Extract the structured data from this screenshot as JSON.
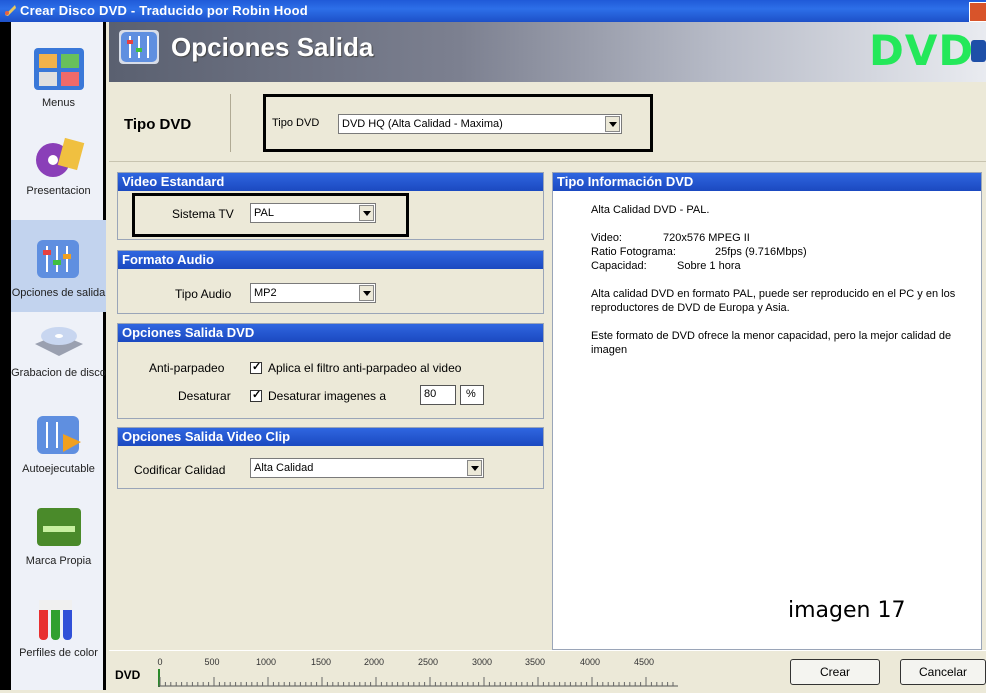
{
  "window": {
    "title": "Crear Disco DVD - Traducido por Robin Hood"
  },
  "sidebar": {
    "items": [
      {
        "label": "Menus",
        "icon": "menus-icon"
      },
      {
        "label": "Presentacion",
        "icon": "presentation-icon"
      },
      {
        "label": "Opciones de salida",
        "icon": "output-options-icon",
        "active": true
      },
      {
        "label": "Grabacion de disco",
        "icon": "disc-burn-icon"
      },
      {
        "label": "Autoejecutable",
        "icon": "autorun-icon"
      },
      {
        "label": "Marca Propia",
        "icon": "branding-icon"
      },
      {
        "label": "Perfiles de color",
        "icon": "color-profiles-icon"
      }
    ]
  },
  "header": {
    "title": "Opciones Salida",
    "badge": "DVD"
  },
  "tipo_dvd": {
    "section_label": "Tipo DVD",
    "field_label": "Tipo DVD",
    "value": "DVD HQ (Alta Calidad - Maxima)"
  },
  "video_estandard": {
    "title": "Video Estandard",
    "sistema_label": "Sistema TV",
    "sistema_value": "PAL"
  },
  "formato_audio": {
    "title": "Formato Audio",
    "tipo_label": "Tipo Audio",
    "tipo_value": "MP2"
  },
  "opciones_salida_dvd": {
    "title": "Opciones Salida DVD",
    "antiparpadeo_label": "Anti-parpadeo",
    "antiparpadeo_text": "Aplica el filtro anti-parpadeo al video",
    "antiparpadeo_checked": true,
    "desaturar_label": "Desaturar",
    "desaturar_text": "Desaturar imagenes a",
    "desaturar_checked": true,
    "desaturar_value": "80",
    "percent": "%"
  },
  "opciones_video_clip": {
    "title": "Opciones Salida Video Clip",
    "calidad_label": "Codificar Calidad",
    "calidad_value": "Alta Calidad"
  },
  "info": {
    "title": "Tipo Información DVD",
    "line1": "Alta Calidad DVD - PAL.",
    "video_k": "Video:",
    "video_v": "720x576 MPEG II",
    "ratio_k": "Ratio Fotograma:",
    "ratio_v": "25fps (9.716Mbps)",
    "cap_k": "Capacidad:",
    "cap_v": "Sobre 1 hora",
    "para1": "Alta calidad DVD en formato PAL, puede ser reproducido en el PC y en los reproductores de DVD de Europa y Asia.",
    "para2": "Este formato de DVD ofrece la menor capacidad, pero la mejor calidad de imagen"
  },
  "caption": "imagen 17",
  "bottom": {
    "dvd_label": "DVD",
    "ticks": [
      "0",
      "500",
      "1000",
      "1500",
      "2000",
      "2500",
      "3000",
      "3500",
      "4000",
      "4500"
    ],
    "crear": "Crear",
    "cancelar": "Cancelar"
  }
}
